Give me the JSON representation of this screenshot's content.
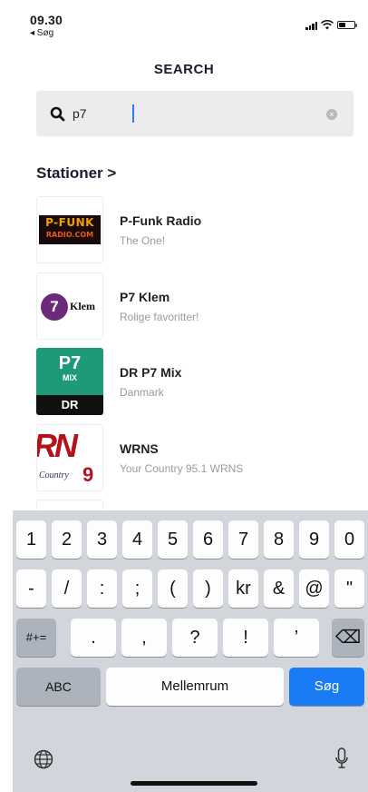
{
  "status": {
    "time": "09.30",
    "back": "◂ Søg"
  },
  "header": {
    "title": "SEARCH"
  },
  "search": {
    "value": "p7",
    "placeholder": ""
  },
  "section": {
    "title": "Stationer >"
  },
  "stations": [
    {
      "name": "P-Funk Radio",
      "subtitle": "The One!",
      "logo_text": "P-FUNK",
      "logo_sub": "RADIO.COM"
    },
    {
      "name": "P7 Klem",
      "subtitle": "Rolige favoritter!",
      "logo_text": "7",
      "logo_sub": "Klem"
    },
    {
      "name": "DR P7 Mix",
      "subtitle": "Danmark",
      "logo_text": "P7",
      "logo_sub": "MIX",
      "logo_brand": "DR"
    },
    {
      "name": "WRNS",
      "subtitle": "Your Country 95.1 WRNS",
      "logo_text": "RN",
      "logo_sub": "Country",
      "logo_num": "9"
    }
  ],
  "keyboard": {
    "row1": [
      "1",
      "2",
      "3",
      "4",
      "5",
      "6",
      "7",
      "8",
      "9",
      "0"
    ],
    "row2": [
      "-",
      "/",
      ":",
      ";",
      "(",
      ")",
      "kr",
      "&",
      "@",
      "\""
    ],
    "row3": [
      "#+=",
      ".",
      ",",
      "?",
      "!",
      "’",
      "⌫"
    ],
    "abc": "ABC",
    "space": "Mellemrum",
    "go": "Søg"
  },
  "colors": {
    "accent": "#1a7cf4",
    "keyboard_bg": "#d2d5db",
    "search_bg": "#ececec"
  }
}
